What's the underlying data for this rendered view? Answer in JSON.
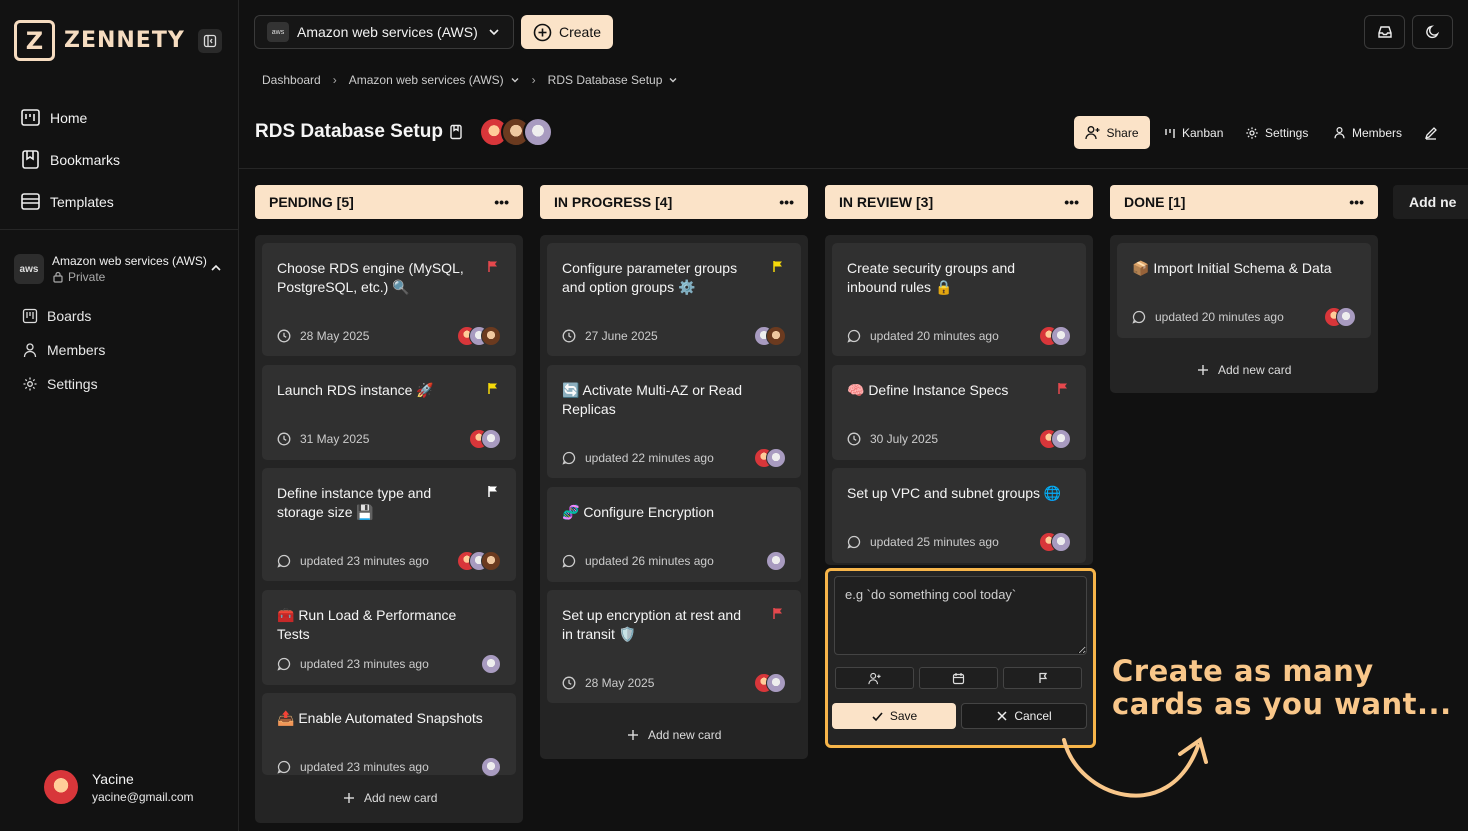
{
  "brand": {
    "logo_letter": "Z",
    "name": "ZENNETY"
  },
  "nav": [
    {
      "label": "Home",
      "icon": "home-icon"
    },
    {
      "label": "Bookmarks",
      "icon": "bookmark-icon"
    },
    {
      "label": "Templates",
      "icon": "template-icon"
    }
  ],
  "workspace": {
    "logo": "aws",
    "name": "Amazon web services (AWS)",
    "visibility": "Private"
  },
  "workspace_nav": [
    {
      "label": "Boards",
      "icon": "board-icon"
    },
    {
      "label": "Members",
      "icon": "user-icon"
    },
    {
      "label": "Settings",
      "icon": "gear-icon"
    }
  ],
  "user": {
    "name": "Yacine",
    "email": "yacine@gmail.com"
  },
  "topbar": {
    "workspace_select": "Amazon web services (AWS)",
    "create_label": "Create"
  },
  "breadcrumb": [
    "Dashboard",
    "Amazon web services (AWS)",
    "RDS Database Setup"
  ],
  "board": {
    "title": "RDS Database Setup"
  },
  "actions": {
    "share": "Share",
    "kanban": "Kanban",
    "settings": "Settings",
    "members": "Members"
  },
  "columns": [
    {
      "title": "PENDING [5]",
      "add_label": "Add new card",
      "cards": [
        {
          "title": "Choose RDS engine (MySQL, PostgreSQL, etc.) 🔍",
          "meta": "28 May 2025",
          "meta_icon": "clock",
          "flag": "#e5484d",
          "avatars": [
            "red",
            "purple",
            "brown"
          ]
        },
        {
          "title": "Launch RDS instance 🚀",
          "meta": "31 May 2025",
          "meta_icon": "clock",
          "flag": "#f5d90a",
          "avatars": [
            "red",
            "purple"
          ]
        },
        {
          "title": "Define instance type and storage size 💾",
          "meta": "updated 23 minutes ago",
          "meta_icon": "comment",
          "flag": "#ffffff",
          "avatars": [
            "red",
            "purple",
            "brown"
          ]
        },
        {
          "title": "🧰 Run Load & Performance Tests",
          "meta": "updated 23 minutes ago",
          "meta_icon": "comment",
          "flag": "",
          "avatars": [
            "purple"
          ]
        },
        {
          "title": "📤 Enable Automated Snapshots",
          "meta": "updated 23 minutes ago",
          "meta_icon": "comment",
          "flag": "",
          "avatars": [
            "purple"
          ]
        }
      ]
    },
    {
      "title": "IN PROGRESS [4]",
      "add_label": "Add new card",
      "cards": [
        {
          "title": "Configure parameter groups and option groups ⚙️",
          "meta": "27 June 2025",
          "meta_icon": "clock",
          "flag": "#f5d90a",
          "avatars": [
            "purple",
            "brown"
          ]
        },
        {
          "title": "🔄 Activate Multi-AZ or Read Replicas",
          "meta": "updated 22 minutes ago",
          "meta_icon": "comment",
          "flag": "",
          "avatars": [
            "red",
            "purple"
          ]
        },
        {
          "title": "🧬 Configure Encryption",
          "meta": "updated 26 minutes ago",
          "meta_icon": "comment",
          "flag": "",
          "avatars": [
            "purple"
          ]
        },
        {
          "title": "Set up encryption at rest and in transit 🛡️",
          "meta": "28 May 2025",
          "meta_icon": "clock",
          "flag": "#e5484d",
          "avatars": [
            "red",
            "purple"
          ]
        }
      ]
    },
    {
      "title": "IN REVIEW [3]",
      "cards": [
        {
          "title": "Create security groups and inbound rules 🔒",
          "meta": "updated 20 minutes ago",
          "meta_icon": "comment",
          "flag": "",
          "avatars": [
            "red",
            "purple"
          ]
        },
        {
          "title": "🧠 Define Instance Specs",
          "meta": "30 July 2025",
          "meta_icon": "clock",
          "flag": "#e5484d",
          "avatars": [
            "red",
            "purple"
          ]
        },
        {
          "title": "Set up VPC and subnet groups 🌐",
          "meta": "updated 25 minutes ago",
          "meta_icon": "comment",
          "flag": "",
          "avatars": [
            "red",
            "purple"
          ]
        }
      ]
    },
    {
      "title": "DONE [1]",
      "add_label": "Add new card",
      "cards": [
        {
          "title": "📦 Import Initial Schema & Data",
          "meta": "updated 20 minutes ago",
          "meta_icon": "comment",
          "flag": "",
          "avatars": [
            "red",
            "purple"
          ]
        }
      ]
    }
  ],
  "add_column_label": "Add ne",
  "composer": {
    "placeholder": "e.g `do something cool today`",
    "save": "Save",
    "cancel": "Cancel"
  },
  "promo": {
    "line1": "Create as many",
    "line2": "cards as you want..."
  },
  "colors": {
    "accent": "#fbe3c8",
    "highlight": "#f7b54a",
    "background": "#111111"
  }
}
